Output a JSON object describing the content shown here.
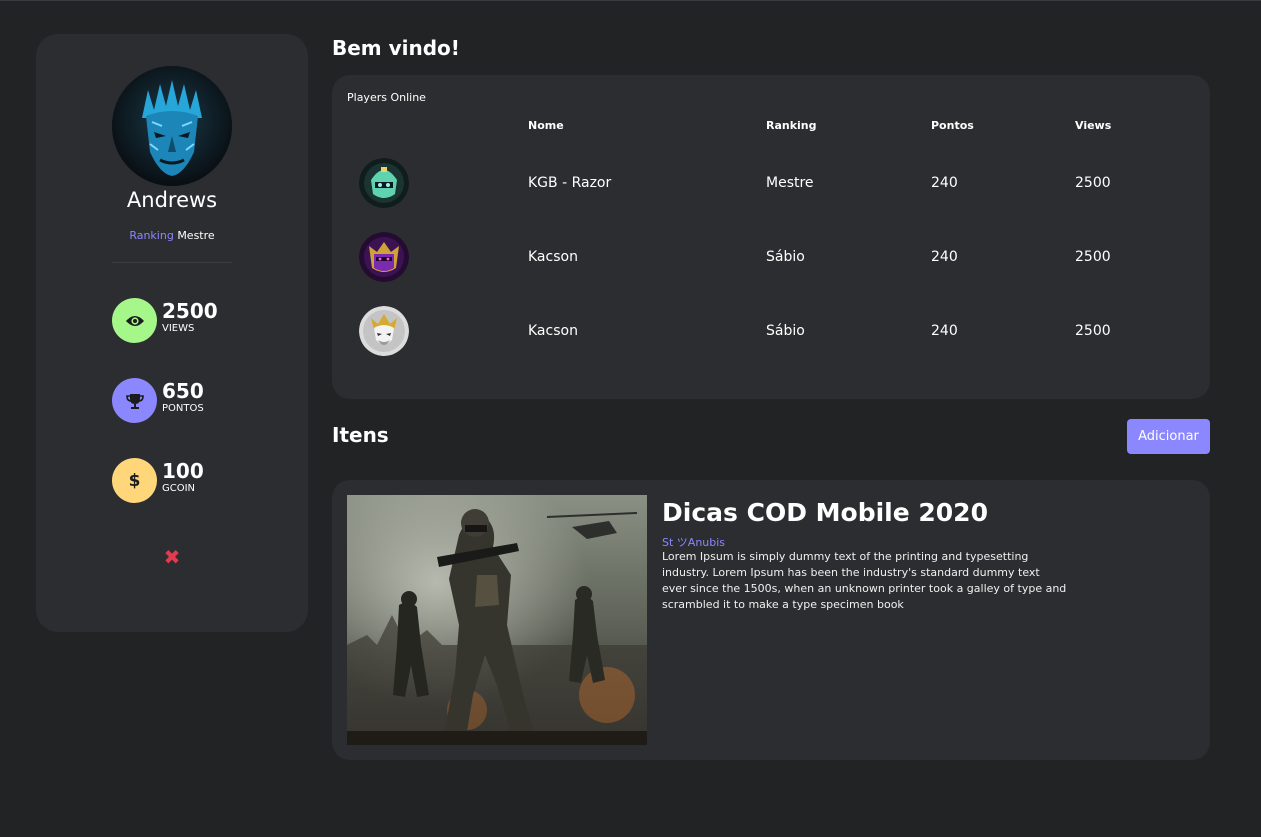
{
  "profile": {
    "name": "Andrews",
    "ranking_label": "Ranking",
    "ranking_value": "Mestre",
    "stats": [
      {
        "value": "2500",
        "label": "VIEWS",
        "icon": "eye-icon",
        "color": "#a6f78a"
      },
      {
        "value": "650",
        "label": "PONTOS",
        "icon": "trophy-icon",
        "color": "#8b87ff"
      },
      {
        "value": "100",
        "label": "GCOIN",
        "icon": "dollar-icon",
        "color": "#ffd77a"
      }
    ],
    "close_symbol": "✖"
  },
  "main": {
    "welcome": "Bem vindo!",
    "players": {
      "title": "Players Online",
      "columns": [
        "Nome",
        "Ranking",
        "Pontos",
        "Views"
      ],
      "rows": [
        {
          "name": "KGB - Razor",
          "ranking": "Mestre",
          "points": "240",
          "views": "2500"
        },
        {
          "name": "Kacson",
          "ranking": "Sábio",
          "points": "240",
          "views": "2500"
        },
        {
          "name": "Kacson",
          "ranking": "Sábio",
          "points": "240",
          "views": "2500"
        }
      ]
    },
    "items_title": "Itens",
    "add_label": "Adicionar",
    "item": {
      "title": "Dicas COD Mobile 2020",
      "author": "St ツAnubis",
      "description": "Lorem Ipsum is simply dummy text of the printing and typesetting industry. Lorem Ipsum has been the industry's standard dummy text ever since the 1500s, when an unknown printer took a galley of type and scrambled it to make a type specimen book"
    }
  },
  "colors": {
    "background": "#222325",
    "card": "#2c2d30",
    "accent": "#8b87ff",
    "danger": "#e23a4e"
  }
}
